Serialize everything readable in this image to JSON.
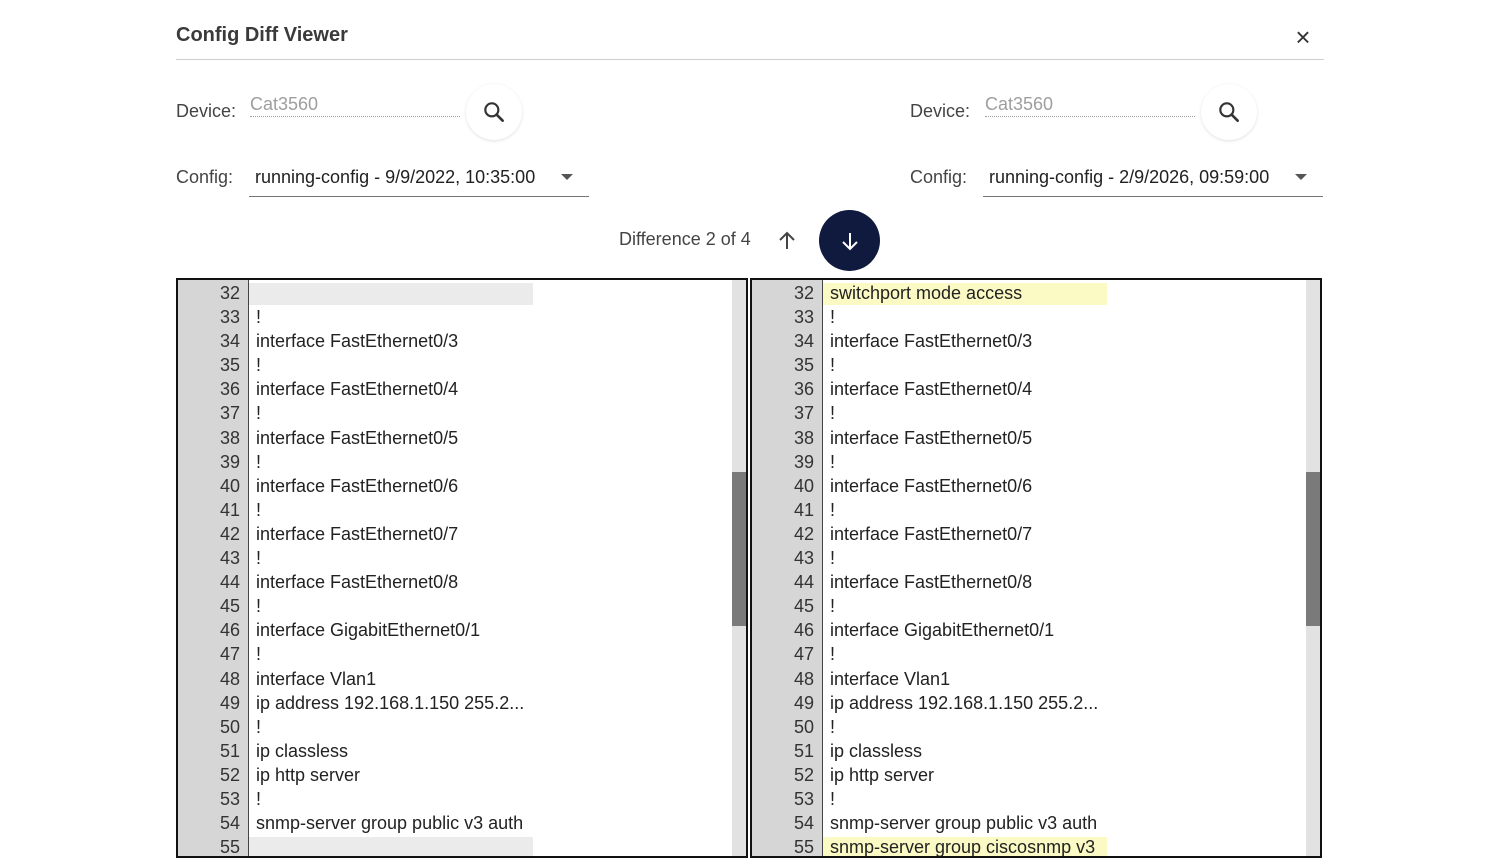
{
  "dialog": {
    "title": "Config Diff Viewer",
    "close_glyph": "×"
  },
  "left": {
    "device_label": "Device:",
    "device_placeholder": "Cat3560",
    "config_label": "Config:",
    "config_value": "running-config - 9/9/2022, 10:35:00"
  },
  "right": {
    "device_label": "Device:",
    "device_placeholder": "Cat3560",
    "config_label": "Config:",
    "config_value": "running-config - 2/9/2026, 09:59:00"
  },
  "nav": {
    "difference_text": "Difference 2 of 4",
    "up_icon": "arrow-up-icon",
    "down_icon": "arrow-down-icon"
  },
  "colors": {
    "accent": "#0f1a3e",
    "highlight_added": "#fbfac5",
    "highlight_missing": "#ebebeb",
    "gutter": "#d6d6d6"
  },
  "left_pane": {
    "lines": [
      {
        "n": "32",
        "text": "",
        "hl": "gray"
      },
      {
        "n": "33",
        "text": "!",
        "hl": ""
      },
      {
        "n": "34",
        "text": "interface FastEthernet0/3",
        "hl": ""
      },
      {
        "n": "35",
        "text": "!",
        "hl": ""
      },
      {
        "n": "36",
        "text": "interface FastEthernet0/4",
        "hl": ""
      },
      {
        "n": "37",
        "text": "!",
        "hl": ""
      },
      {
        "n": "38",
        "text": "interface FastEthernet0/5",
        "hl": ""
      },
      {
        "n": "39",
        "text": "!",
        "hl": ""
      },
      {
        "n": "40",
        "text": "interface FastEthernet0/6",
        "hl": ""
      },
      {
        "n": "41",
        "text": "!",
        "hl": ""
      },
      {
        "n": "42",
        "text": "interface FastEthernet0/7",
        "hl": ""
      },
      {
        "n": "43",
        "text": "!",
        "hl": ""
      },
      {
        "n": "44",
        "text": "interface FastEthernet0/8",
        "hl": ""
      },
      {
        "n": "45",
        "text": "!",
        "hl": ""
      },
      {
        "n": "46",
        "text": "interface GigabitEthernet0/1",
        "hl": ""
      },
      {
        "n": "47",
        "text": "!",
        "hl": ""
      },
      {
        "n": "48",
        "text": "interface Vlan1",
        "hl": ""
      },
      {
        "n": "49",
        "text": "ip address 192.168.1.150 255.2...",
        "hl": ""
      },
      {
        "n": "50",
        "text": "!",
        "hl": ""
      },
      {
        "n": "51",
        "text": "ip classless",
        "hl": ""
      },
      {
        "n": "52",
        "text": "ip http server",
        "hl": ""
      },
      {
        "n": "53",
        "text": "!",
        "hl": ""
      },
      {
        "n": "54",
        "text": "snmp-server group public v3 auth",
        "hl": ""
      },
      {
        "n": "55",
        "text": "",
        "hl": "gray"
      }
    ]
  },
  "right_pane": {
    "lines": [
      {
        "n": "32",
        "text": "switchport mode access",
        "hl": "yellow"
      },
      {
        "n": "33",
        "text": "!",
        "hl": ""
      },
      {
        "n": "34",
        "text": "interface FastEthernet0/3",
        "hl": ""
      },
      {
        "n": "35",
        "text": "!",
        "hl": ""
      },
      {
        "n": "36",
        "text": "interface FastEthernet0/4",
        "hl": ""
      },
      {
        "n": "37",
        "text": "!",
        "hl": ""
      },
      {
        "n": "38",
        "text": "interface FastEthernet0/5",
        "hl": ""
      },
      {
        "n": "39",
        "text": "!",
        "hl": ""
      },
      {
        "n": "40",
        "text": "interface FastEthernet0/6",
        "hl": ""
      },
      {
        "n": "41",
        "text": "!",
        "hl": ""
      },
      {
        "n": "42",
        "text": "interface FastEthernet0/7",
        "hl": ""
      },
      {
        "n": "43",
        "text": "!",
        "hl": ""
      },
      {
        "n": "44",
        "text": "interface FastEthernet0/8",
        "hl": ""
      },
      {
        "n": "45",
        "text": "!",
        "hl": ""
      },
      {
        "n": "46",
        "text": "interface GigabitEthernet0/1",
        "hl": ""
      },
      {
        "n": "47",
        "text": "!",
        "hl": ""
      },
      {
        "n": "48",
        "text": "interface Vlan1",
        "hl": ""
      },
      {
        "n": "49",
        "text": "ip address 192.168.1.150 255.2...",
        "hl": ""
      },
      {
        "n": "50",
        "text": "!",
        "hl": ""
      },
      {
        "n": "51",
        "text": "ip classless",
        "hl": ""
      },
      {
        "n": "52",
        "text": "ip http server",
        "hl": ""
      },
      {
        "n": "53",
        "text": "!",
        "hl": ""
      },
      {
        "n": "54",
        "text": "snmp-server group public v3 auth",
        "hl": ""
      },
      {
        "n": "55",
        "text": "snmp-server group ciscosnmp v3",
        "hl": "yellow"
      }
    ]
  }
}
